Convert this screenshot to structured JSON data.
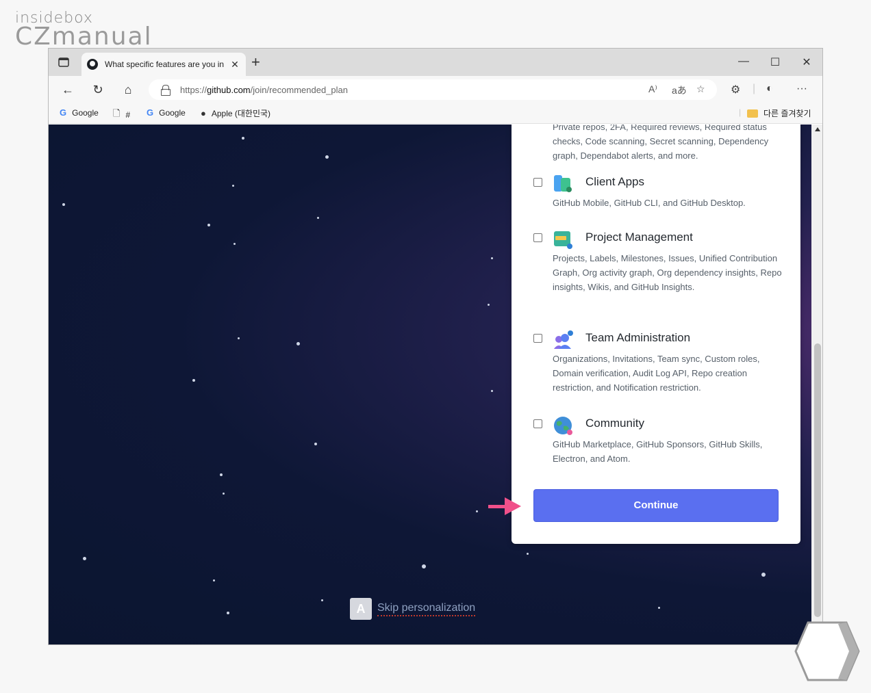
{
  "watermark": {
    "line1": "insidebox",
    "line2": "CZmanual"
  },
  "browser": {
    "tab_title": "What specific features are you in",
    "url_scheme": "https://",
    "url_host": "github.com",
    "url_path": "/join/recommended_plan",
    "bookmarks": [
      {
        "label": "Google"
      },
      {
        "label": "#"
      },
      {
        "label": "Google"
      },
      {
        "label": "Apple (대한민국)"
      }
    ],
    "other_favorites": "다른 즐겨찾기"
  },
  "card": {
    "truncated_desc": "Private repos, 2FA, Required reviews, Required status checks, Code scanning, Secret scanning, Dependency graph, Dependabot alerts, and more.",
    "options": [
      {
        "label": "Client Apps",
        "checked": false,
        "icon": "client-apps-icon",
        "description": "GitHub Mobile, GitHub CLI, and GitHub Desktop."
      },
      {
        "label": "Project Management",
        "checked": false,
        "icon": "project-management-icon",
        "description": "Projects, Labels, Milestones, Issues, Unified Contribution Graph, Org activity graph, Org dependency insights, Repo insights, Wikis, and GitHub Insights."
      },
      {
        "label": "Team Administration",
        "checked": false,
        "icon": "team-administration-icon",
        "description": "Organizations, Invitations, Team sync, Custom roles, Domain verification, Audit Log API, Repo creation restriction, and Notification restriction."
      },
      {
        "label": "Community",
        "checked": false,
        "icon": "community-icon",
        "description": "GitHub Marketplace, GitHub Sponsors, GitHub Skills, Electron, and Atom."
      }
    ],
    "continue_label": "Continue"
  },
  "skip": {
    "key": "A",
    "label": "Skip personalization"
  },
  "colors": {
    "accent": "#5a6ff0",
    "arrow": "#f0508a",
    "background": "#0b1530"
  }
}
